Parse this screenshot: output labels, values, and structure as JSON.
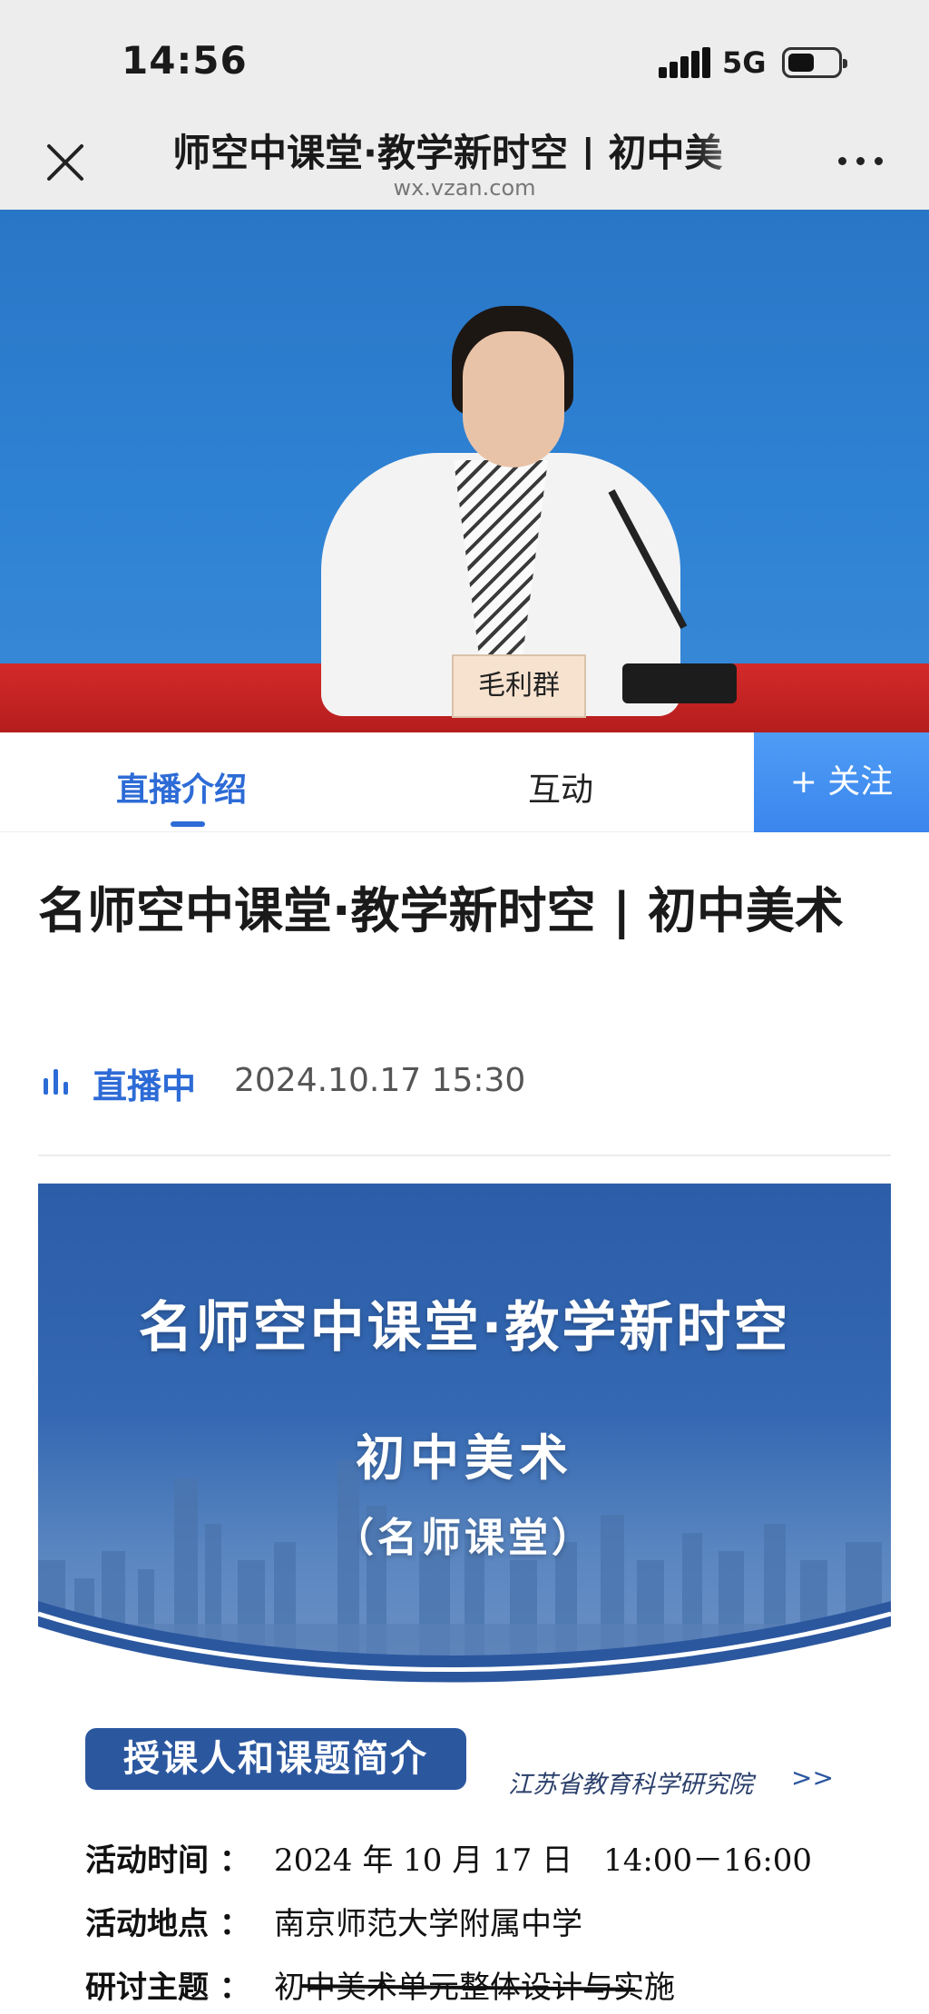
{
  "status_bar": {
    "time": "14:56",
    "network": "5G"
  },
  "nav": {
    "title": "师空中课堂·教学新时空 | 初中美",
    "domain": "wx.vzan.com"
  },
  "video": {
    "nameplate": "毛利群"
  },
  "tabs": {
    "live_intro": "直播介绍",
    "interact": "互动",
    "follow": "+ 关注"
  },
  "content": {
    "title": "名师空中课堂·教学新时空 | 初中美术",
    "status_label": "直播中",
    "datetime": "2024.10.17 15:30"
  },
  "poster": {
    "headline": "名师空中课堂·教学新时空",
    "subject": "初中美术",
    "category": "（名师课堂）",
    "intro_tag": "授课人和课题简介",
    "institute": "江苏省教育科学研究院",
    "institute_arrow": ">>",
    "info": [
      {
        "label": "活动时间 ：",
        "value": "2024 年 10 月 17 日　14:00－16:00"
      },
      {
        "label": "活动地点 ：",
        "value": "南京师范大学附属中学"
      },
      {
        "label": "研讨主题 ：",
        "value": "初中美术单元整体设计与实施"
      }
    ]
  },
  "colors": {
    "accent": "#2d6bd6",
    "follow_bg": "#3a86ee",
    "poster_blue": "#2b579f"
  }
}
